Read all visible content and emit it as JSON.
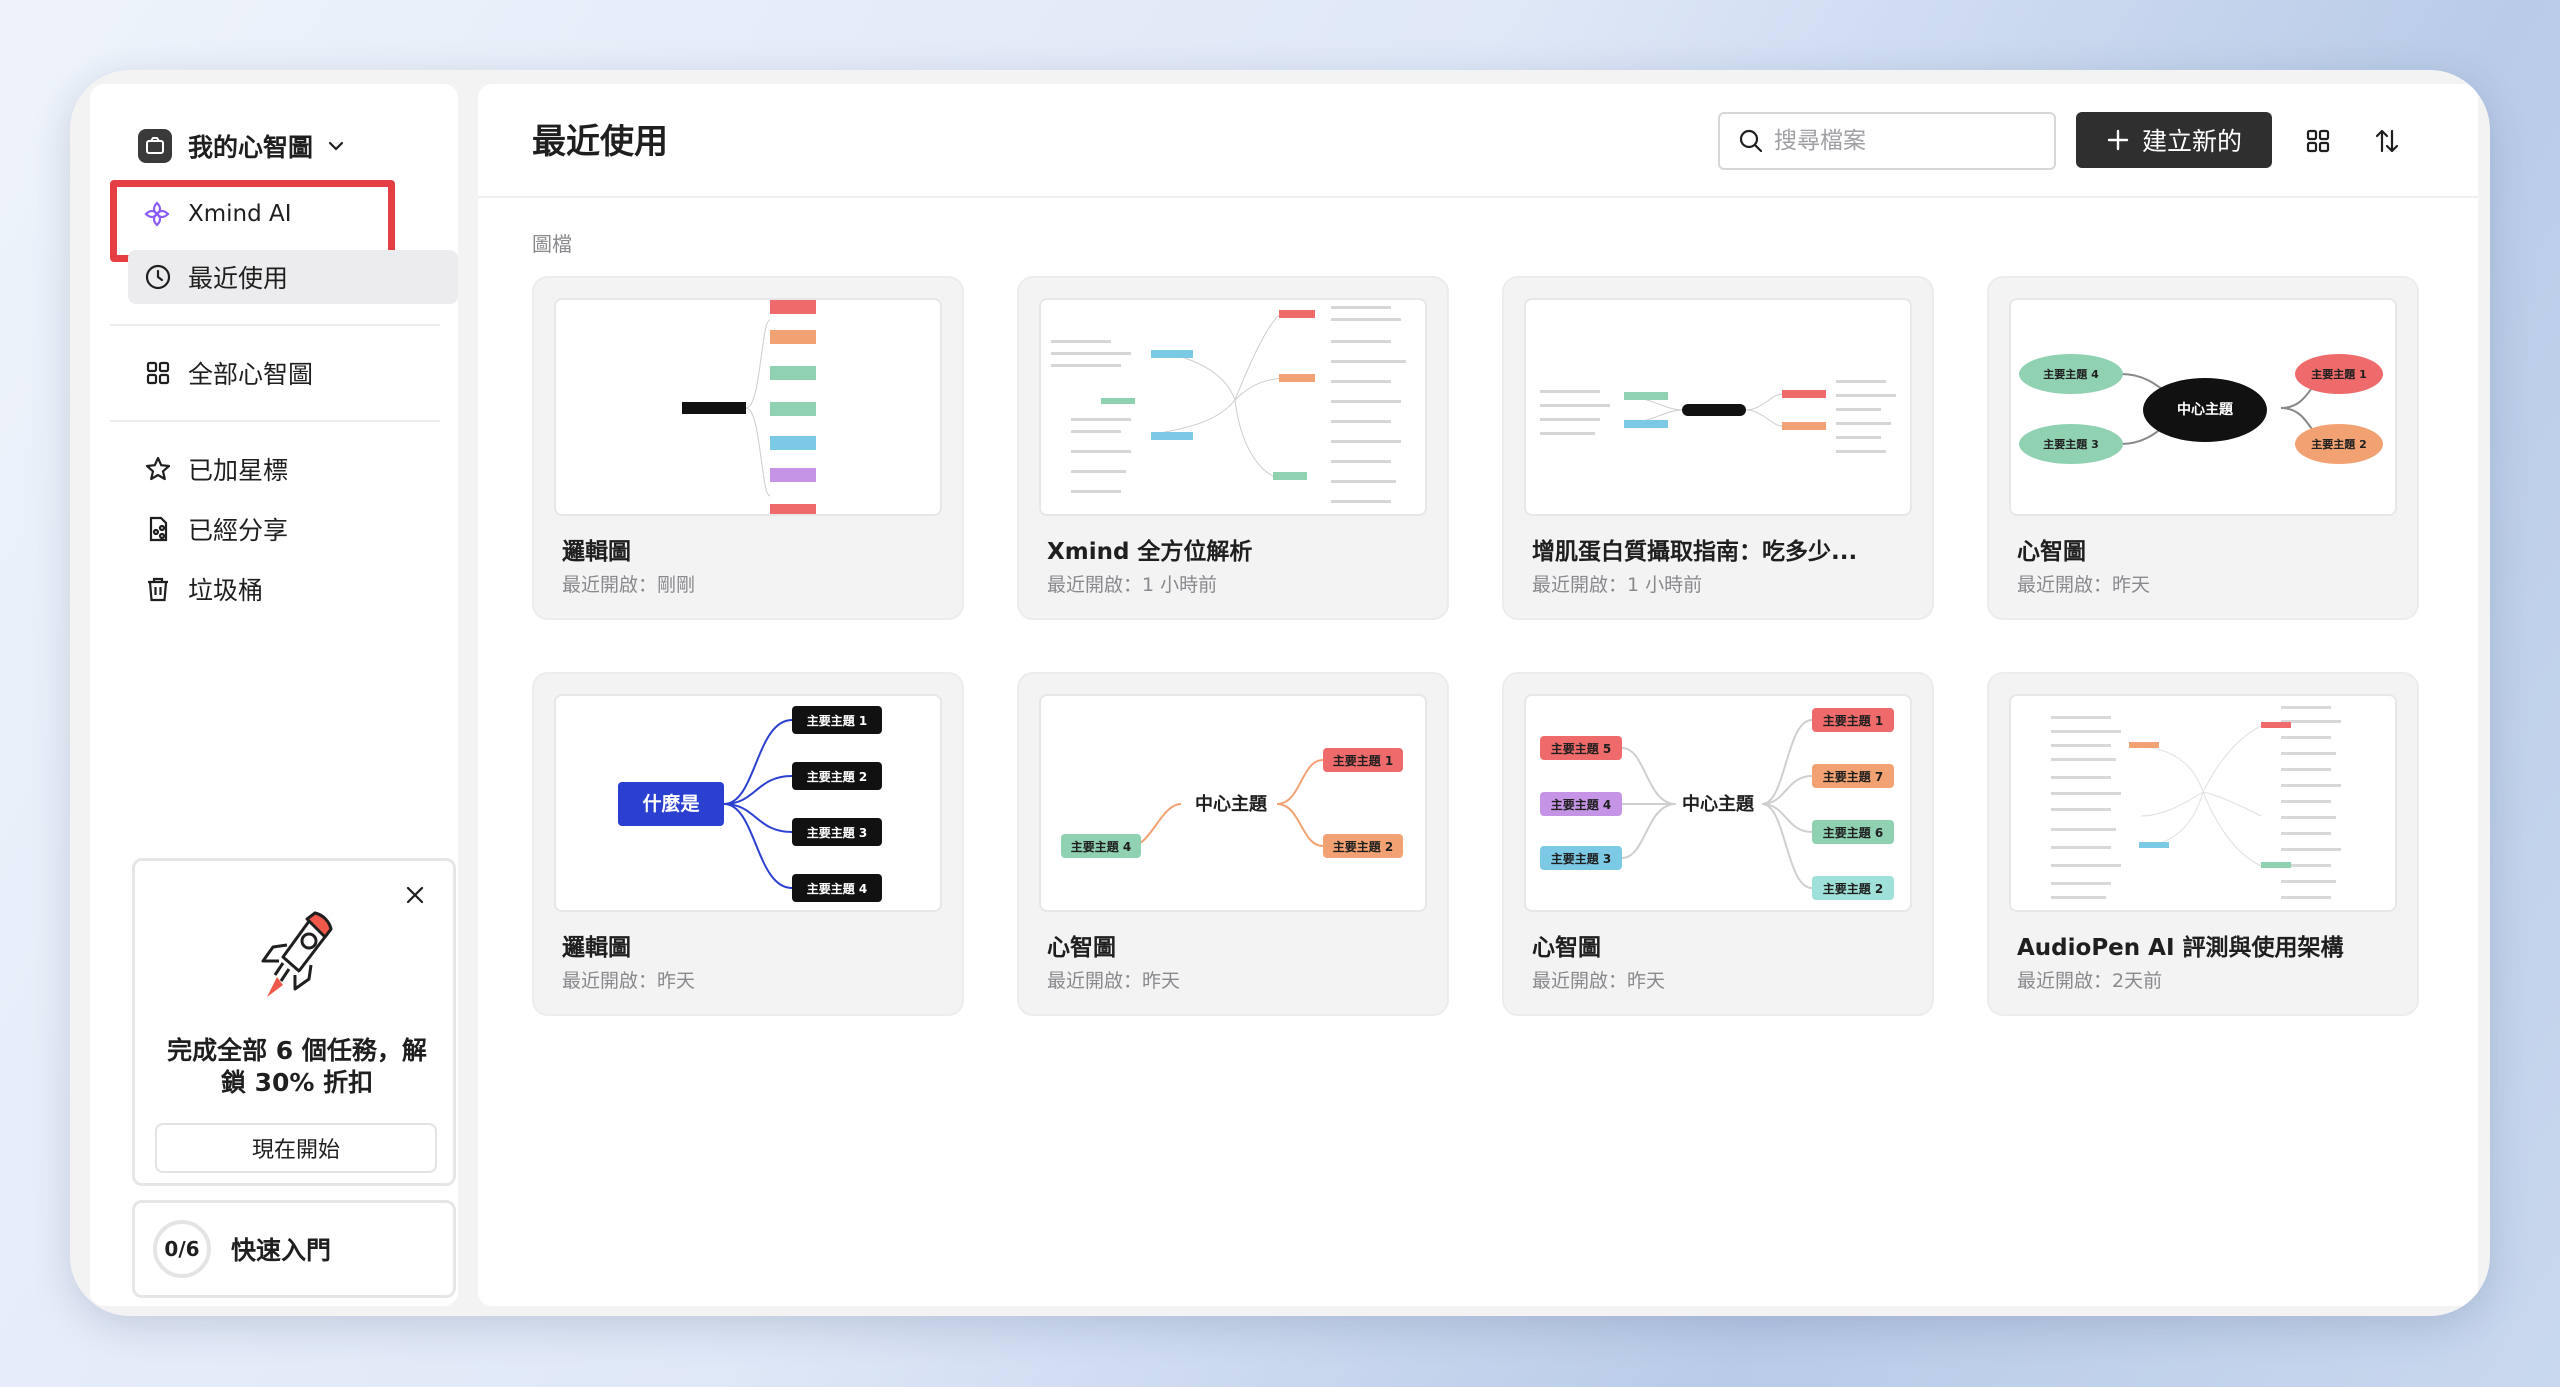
{
  "sidebar": {
    "workspace_title": "我的心智圖",
    "ai_item": "Xmind AI",
    "nav": {
      "recent": "最近使用",
      "all_maps": "全部心智圖",
      "starred": "已加星標",
      "shared": "已經分享",
      "trash": "垃圾桶"
    },
    "promo": {
      "text": "完成全部 6 個任務，解鎖 30% 折扣",
      "button": "現在開始"
    },
    "quick_start": {
      "progress": "0/6",
      "label": "快速入門"
    }
  },
  "main": {
    "title": "最近使用",
    "search_placeholder": "搜尋檔案",
    "create_label": "建立新的",
    "section_label": "圖檔",
    "cards": [
      {
        "title": "邏輯圖",
        "meta": "最近開啟：剛剛"
      },
      {
        "title": "Xmind 全方位解析",
        "meta": "最近開啟：1 小時前"
      },
      {
        "title": "增肌蛋白質攝取指南：吃多少...",
        "meta": "最近開啟：1 小時前"
      },
      {
        "title": "心智圖",
        "meta": "最近開啟：昨天"
      },
      {
        "title": "邏輯圖",
        "meta": "最近開啟：昨天"
      },
      {
        "title": "心智圖",
        "meta": "最近開啟：昨天"
      },
      {
        "title": "心智圖",
        "meta": "最近開啟：昨天"
      },
      {
        "title": "AudioPen AI 評測與使用架構",
        "meta": "最近開啟：2天前"
      }
    ],
    "thumbs": {
      "mind4": {
        "center": "中心主題",
        "t1": "主要主題 1",
        "t2": "主要主題 2",
        "t3": "主要主題 3",
        "t4": "主要主題 4"
      },
      "logic": {
        "root": "什麼是",
        "t1": "主要主題 1",
        "t2": "主要主題 2",
        "t3": "主要主題 3",
        "t4": "主要主題 4"
      },
      "mind3": {
        "center": "中心主題",
        "t1": "主要主題 1",
        "t2": "主要主題 2",
        "t4": "主要主題 4"
      },
      "mind7": {
        "center": "中心主題",
        "t1": "主要主題 1",
        "t2": "主要主題 2",
        "t3": "主要主題 3",
        "t4": "主要主題 4",
        "t5": "主要主題 5",
        "t6": "主要主題 6",
        "t7": "主要主題 7"
      }
    }
  },
  "colors": {
    "highlight": "#e53e43",
    "ai_purple": "#8a5cf6",
    "logic_blue": "#2b3fd1"
  }
}
